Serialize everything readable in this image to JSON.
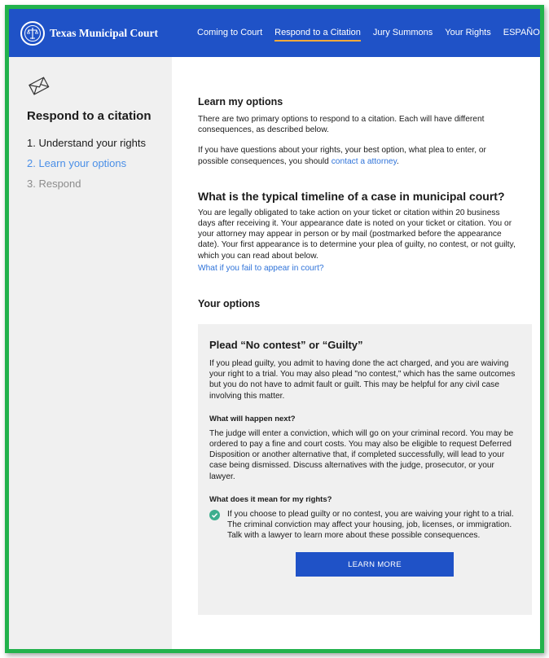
{
  "header": {
    "brand": "Texas Municipal Court",
    "nav": [
      {
        "label": "Coming to Court"
      },
      {
        "label": "Respond to a Citation",
        "active": true
      },
      {
        "label": "Jury Summons"
      },
      {
        "label": "Your Rights"
      },
      {
        "label": "ESPAÑOL"
      }
    ]
  },
  "sidebar": {
    "icon": "envelope-icon",
    "title": "Respond to a citation",
    "steps": [
      {
        "label": "1. Understand your rights",
        "state": "done"
      },
      {
        "label": "2. Learn your options",
        "state": "current"
      },
      {
        "label": "3. Respond",
        "state": "upcoming"
      }
    ]
  },
  "main": {
    "learn": {
      "heading": "Learn my options",
      "p1": "There are two primary options to respond to a citation. Each will have different consequences, as described below.",
      "p2_before": "If you have questions about your rights, your best option, what plea to enter, or possible consequences, you should ",
      "p2_link": "contact a attorney",
      "p2_after": "."
    },
    "timeline": {
      "heading": "What is the typical timeline of a case in municipal court?",
      "body": "You are legally obligated to take action on your ticket or citation within 20 business days after receiving it. Your appearance date is noted on your ticket or citation. You or your attorney may appear in person or by mail (postmarked before the appearance date). Your first appearance is to determine your plea of guilty, no contest, or not guilty, which you can read about below.",
      "link": "What if you fail to appear in court?"
    },
    "options": {
      "heading": "Your options",
      "card": {
        "title": "Plead “No contest” or “Guilty”",
        "body": "If you plead guilty, you admit to having done the act charged, and you are waiving your right to a trial. You may also plead \"no contest,\" which has the same outcomes but you do not have to admit fault or guilt. This may be helpful for any civil case involving this matter.",
        "next_heading": "What will happen next?",
        "next_body": "The judge will enter a conviction, which will go on your criminal record. You may be ordered to pay a fine and court costs. You may also be eligible to request Deferred Disposition or another alternative that, if completed successfully, will lead to your case being dismissed. Discuss alternatives with the judge, prosecutor, or your lawyer.",
        "rights_heading": "What does it mean for my rights?",
        "rights_body": "If you choose to plead guilty or no contest, you are waiving your right to a trial. The criminal conviction may affect your housing, job, licenses, or immigration. Talk with a lawyer to learn more about these possible consequences.",
        "button": "LEARN MORE"
      }
    }
  },
  "colors": {
    "header_bg": "#1f52c7",
    "active_underline": "#f2a93b",
    "frame_border": "#22b24c",
    "link": "#2f73d9",
    "current_step": "#4a8fe7",
    "check": "#3cae8e",
    "sidebar_bg": "#f0f0f0"
  }
}
